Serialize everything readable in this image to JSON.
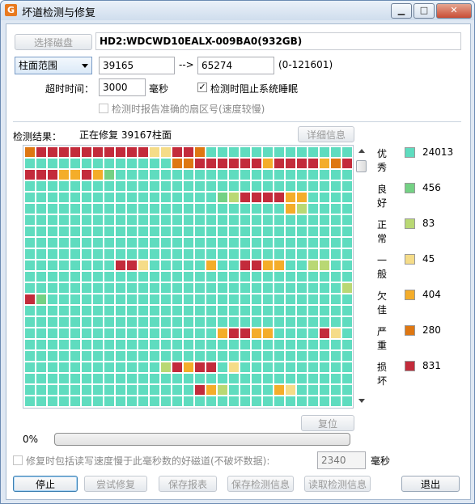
{
  "window": {
    "title": "坏道检测与修复",
    "app_icon_glyph": "G",
    "minimize": "▁",
    "maximize": "□",
    "close": "✕"
  },
  "disk": {
    "select_button": "选择磁盘",
    "name": "HD2:WDCWD10EALX-009BA0(932GB)"
  },
  "range": {
    "mode": "柱面范围",
    "start": "39165",
    "arrow": "-->",
    "end": "65274",
    "limit": "(0-121601)"
  },
  "timeout": {
    "label": "超时时间：",
    "value": "3000",
    "unit": "毫秒"
  },
  "options": {
    "prevent_sleep_label": "检测时阻止系统睡眠",
    "prevent_sleep_checked": true,
    "report_sector_label": "检测时报告准确的扇区号(速度较慢)",
    "report_sector_checked": false
  },
  "results": {
    "label": "检测结果：",
    "status": "正在修复 39167柱面",
    "detail_button": "详细信息"
  },
  "legend": [
    {
      "label": "优秀",
      "count": "24013",
      "color": "#5fdcbf"
    },
    {
      "label": "良好",
      "count": "456",
      "color": "#74d184"
    },
    {
      "label": "正常",
      "count": "83",
      "color": "#b9d874"
    },
    {
      "label": "一般",
      "count": "45",
      "color": "#f5dc88"
    },
    {
      "label": "欠佳",
      "count": "404",
      "color": "#f4ad2a"
    },
    {
      "label": "严重",
      "count": "280",
      "color": "#de7712"
    },
    {
      "label": "损坏",
      "count": "831",
      "color": "#c32b3b"
    }
  ],
  "grid": {
    "columns": 29,
    "rows": 22,
    "palette": {
      "0": "#5fdcbf",
      "1": "#74d184",
      "2": "#b9d874",
      "3": "#f5dc88",
      "4": "#f4ad2a",
      "5": "#de7712",
      "6": "#c32b3b"
    },
    "rows_data": [
      "56666666666336650000000000000",
      "00000000000005566666646666456",
      "66644641000000000000000000000",
      "00000000000000000000000000000",
      "00000000000000000126666440000",
      "00000000000000000000000420000",
      "00000000000000000000000000000",
      "00000000000000000000000000000",
      "00000000000000000000000000000",
      "00000000000000000000000000000",
      "00000000663000004006644002200",
      "00000000000000000000000000000",
      "00000000000000000000000000002",
      "61000000000000000000000000000",
      "00000000000000000000000000000",
      "00000000000000000000000000000",
      "00000000000000000466440000630",
      "00000000000000000000000000000",
      "00000000000000000000000000000",
      "00000000000026466030000000000",
      "00000000000000000000000000000",
      "00000000000000064200004300000",
      "00000000000000000000000000000",
      "00000000000000000000000000000",
      "00000000000000000000000000000",
      "00000000000000000000000000000",
      "00000000000000000000000000000",
      "00000000000000000000000000000"
    ]
  },
  "reset_button": "复位",
  "progress": {
    "text": "0%",
    "value": 0
  },
  "repair_option": {
    "label": "修复时包括读写速度慢于此毫秒数的好磁道(不破坏数据):",
    "value": "2340",
    "unit": "毫秒",
    "checked": false
  },
  "buttons": {
    "stop": "停止",
    "try_repair": "尝试修复",
    "save_report": "保存报表",
    "save_info": "保存检测信息",
    "load_info": "读取检测信息",
    "exit": "退出"
  }
}
